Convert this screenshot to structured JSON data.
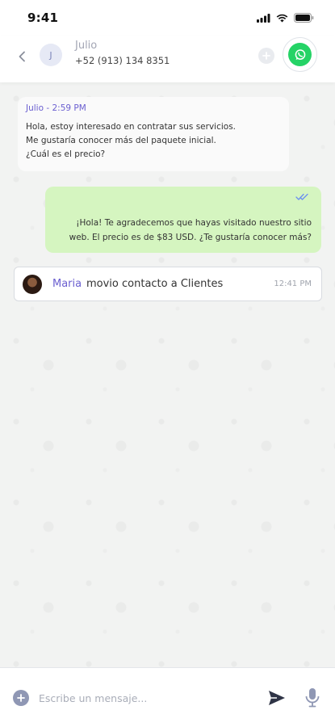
{
  "status_bar": {
    "time": "9:41"
  },
  "header": {
    "avatar_initial": "J",
    "contact_name": "Julio",
    "contact_phone": "+52 (913) 134 8351"
  },
  "messages": {
    "incoming": {
      "sender_time": "Julio - 2:59 PM",
      "lines": [
        "Hola, estoy interesado en contratar sus servicios.",
        "Me gustaría conocer más del paquete inicial.",
        "¿Cuál es el precio?"
      ]
    },
    "outgoing": {
      "lines": [
        "¡Hola! Te agradecemos que hayas visitado nuestro sitio",
        "web. El precio es de $83 USD. ¿Te gustaría conocer más?"
      ]
    },
    "event": {
      "user": "Maria",
      "text": "movio contacto a Clientes",
      "time": "12:41 PM"
    }
  },
  "composer": {
    "placeholder": "Escribe un mensaje..."
  },
  "colors": {
    "accent": "#6b5fd0",
    "outgoing_bubble": "#d5f5c0",
    "whatsapp": "#25d366",
    "chat_background": "#f2f3f2"
  },
  "icons": [
    "back-icon",
    "plus-icon",
    "whatsapp-icon",
    "double-check-icon",
    "attach-plus-icon",
    "send-icon",
    "microphone-icon"
  ]
}
